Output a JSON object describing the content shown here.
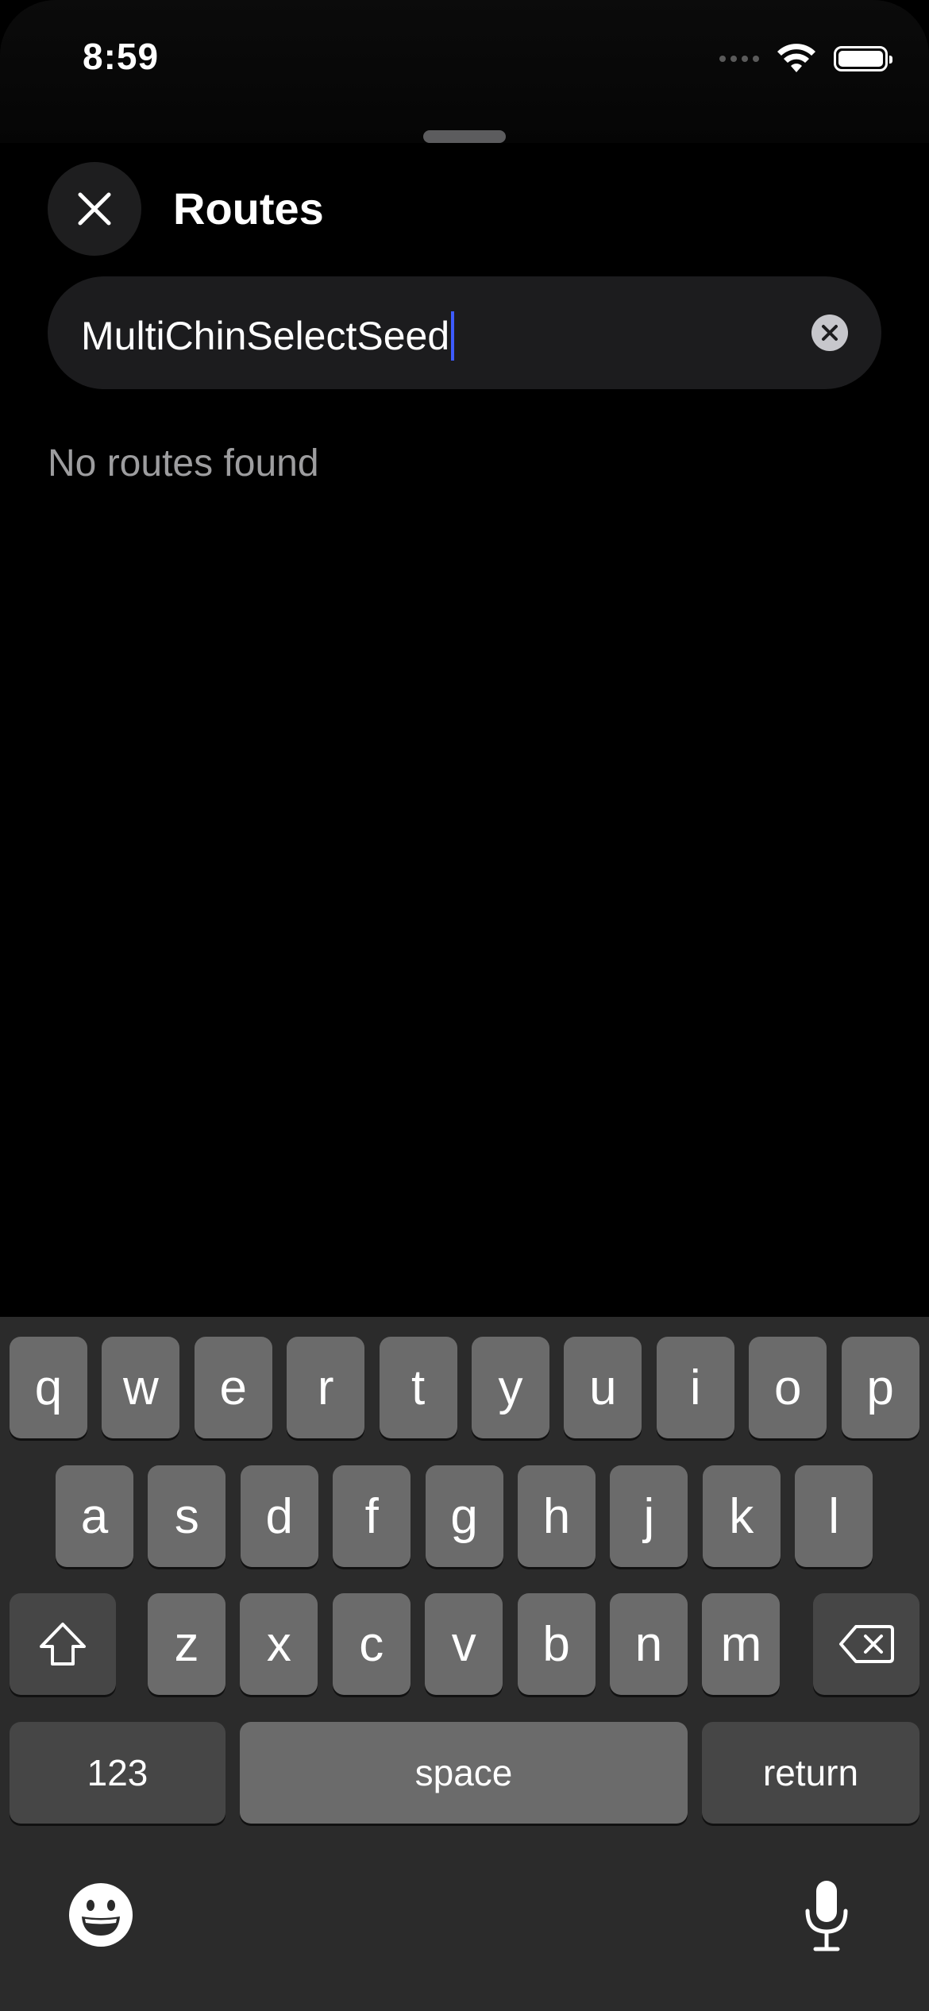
{
  "status_bar": {
    "time": "8:59"
  },
  "header": {
    "title": "Routes"
  },
  "search": {
    "value": "MultiChinSelectSeed"
  },
  "results": {
    "empty_message": "No routes found"
  },
  "keyboard": {
    "row1": [
      "q",
      "w",
      "e",
      "r",
      "t",
      "y",
      "u",
      "i",
      "o",
      "p"
    ],
    "row2": [
      "a",
      "s",
      "d",
      "f",
      "g",
      "h",
      "j",
      "k",
      "l"
    ],
    "row3": [
      "z",
      "x",
      "c",
      "v",
      "b",
      "n",
      "m"
    ],
    "numbers_label": "123",
    "space_label": "space",
    "return_label": "return"
  },
  "colors": {
    "background": "#000000",
    "field": "#1c1c1e",
    "caret": "#3d5bff",
    "key": "#6b6b6b",
    "key_dark": "#464646",
    "keyboard_bg": "#2b2b2b"
  }
}
